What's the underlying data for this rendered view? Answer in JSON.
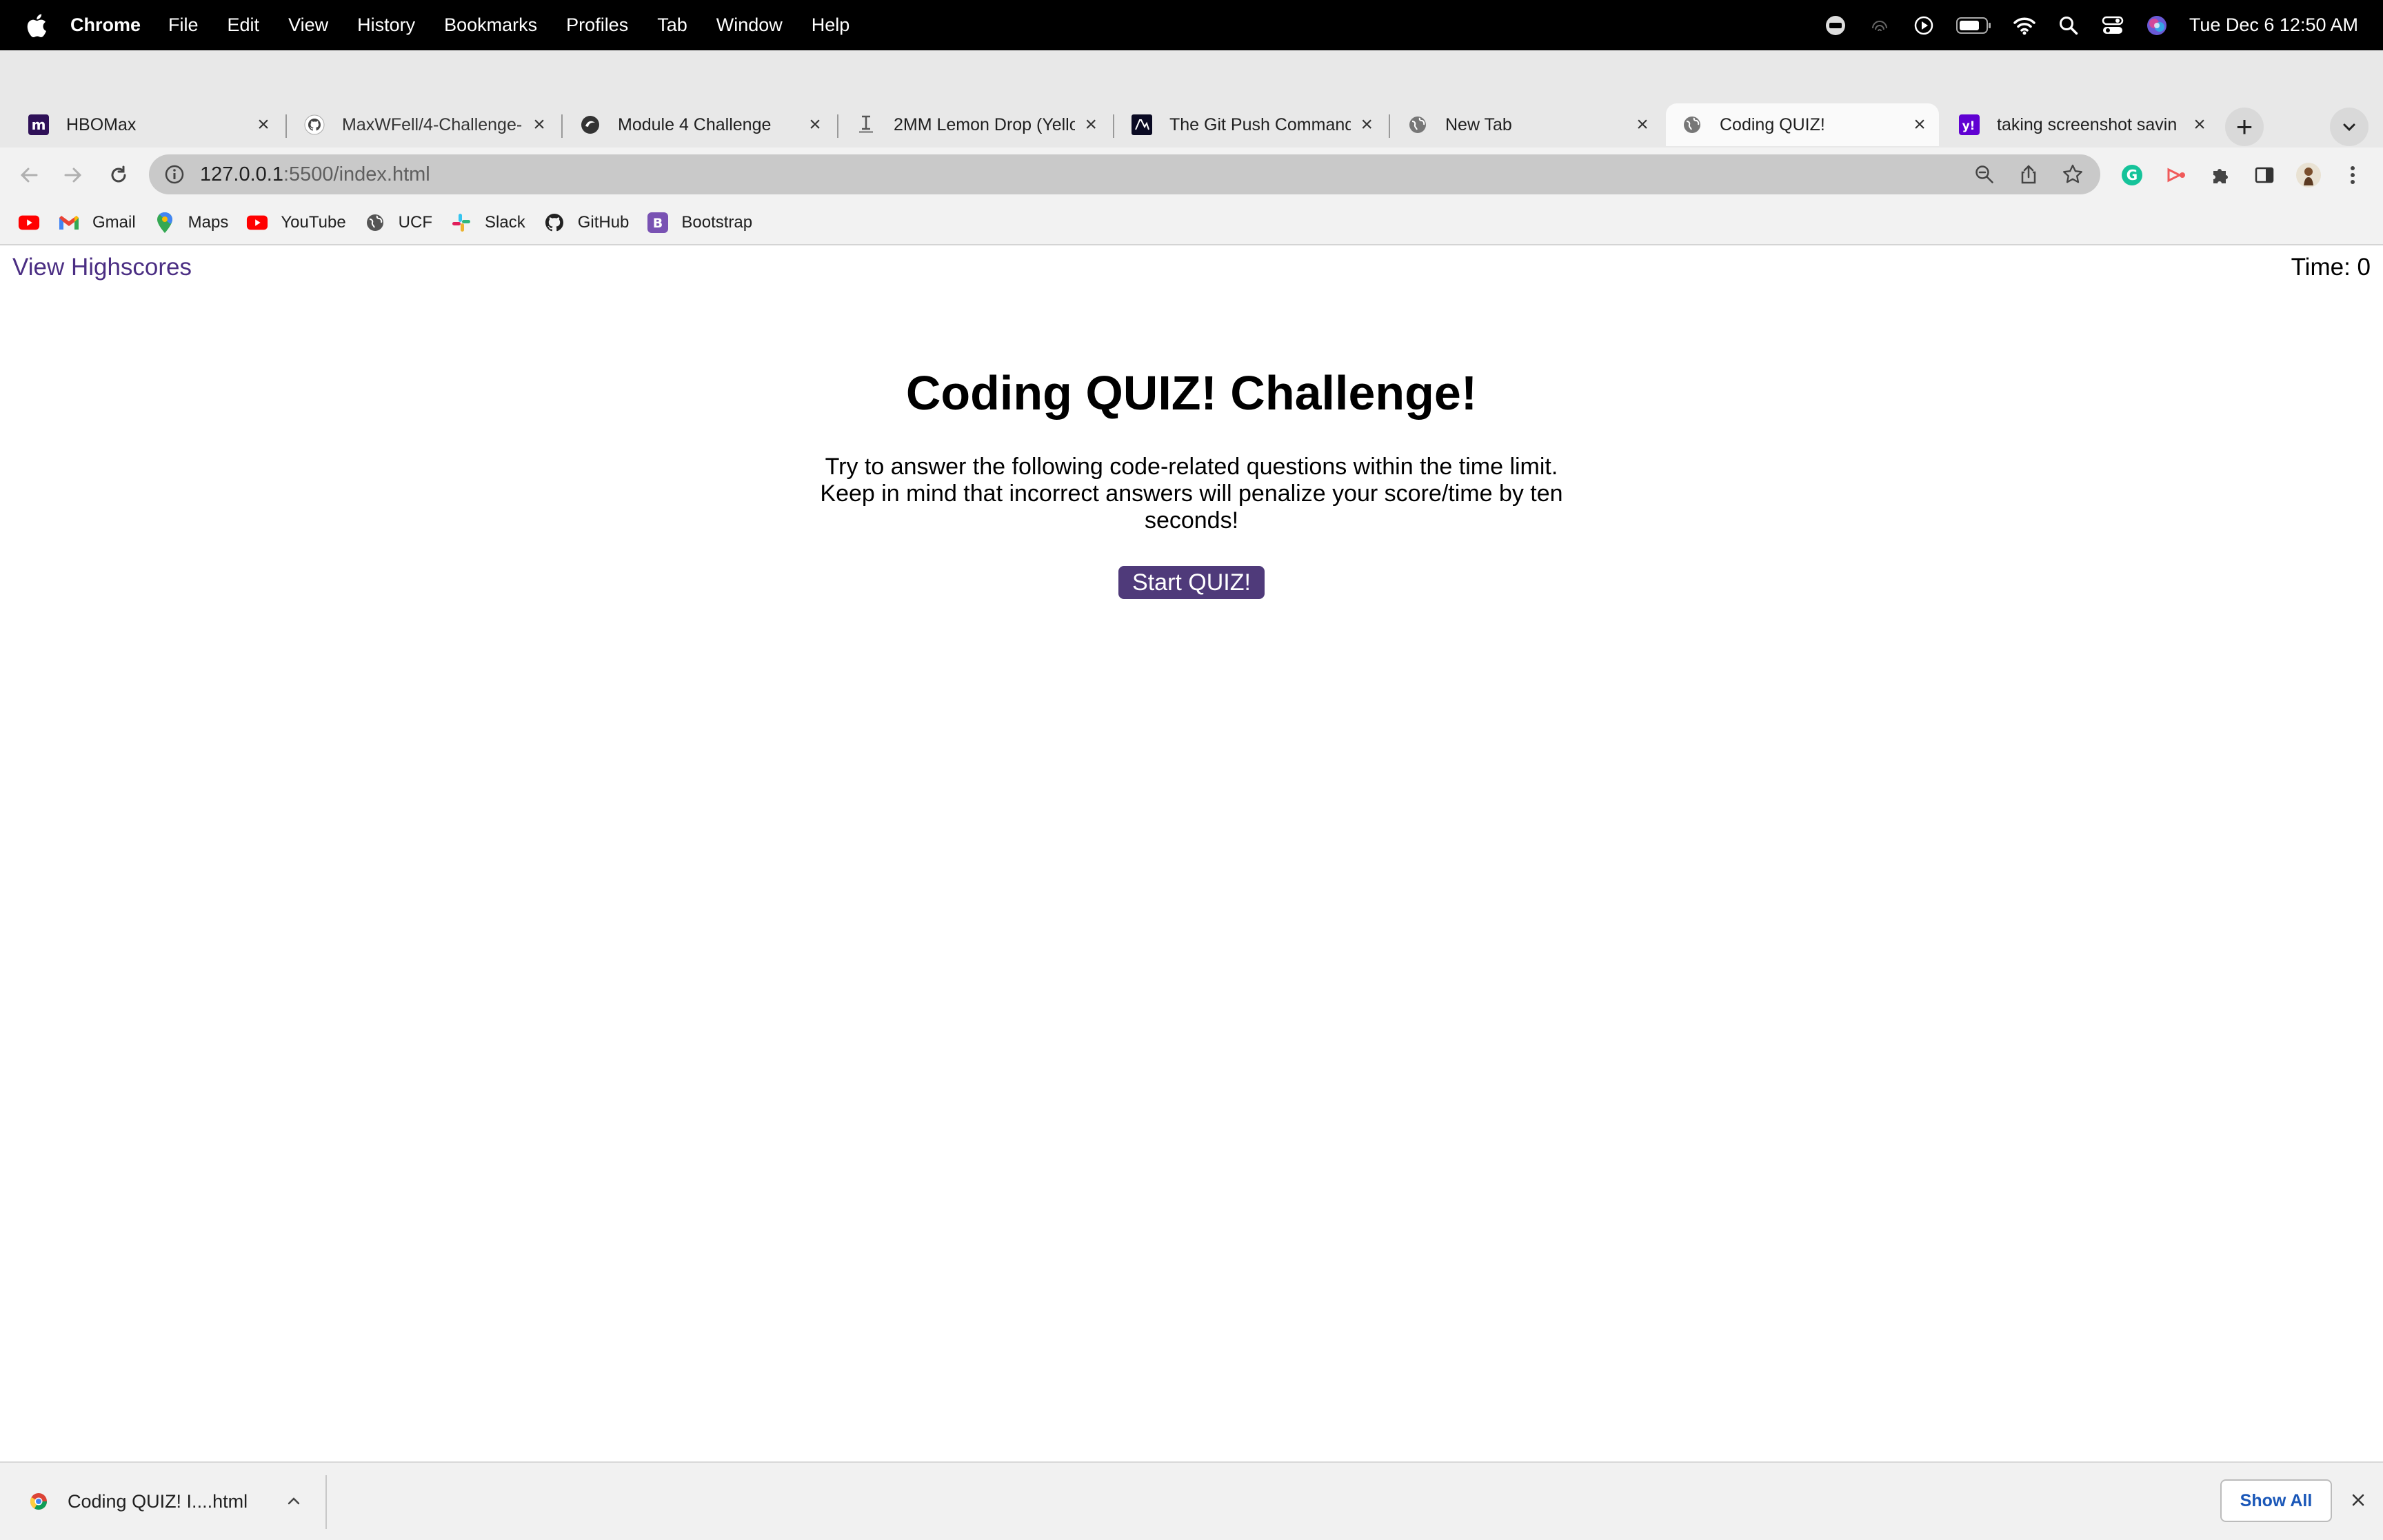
{
  "menubar": {
    "app": "Chrome",
    "items": [
      "File",
      "Edit",
      "View",
      "History",
      "Bookmarks",
      "Profiles",
      "Tab",
      "Window",
      "Help"
    ],
    "clock": "Tue Dec 6  12:50 AM"
  },
  "tabs": [
    {
      "title": "HBOMax",
      "icon": "hbomax-icon"
    },
    {
      "title": "MaxWFell/4-Challenge-",
      "icon": "github-icon"
    },
    {
      "title": "Module 4 Challenge",
      "icon": "canvas-icon"
    },
    {
      "title": "2MM Lemon Drop (Yello",
      "icon": "jacob-icon"
    },
    {
      "title": "The Git Push Command",
      "icon": "freecodecamp-icon"
    },
    {
      "title": "New Tab",
      "icon": "globe-icon"
    },
    {
      "title": "Coding QUIZ!",
      "icon": "globe-icon",
      "active": true
    },
    {
      "title": "taking screenshot savin",
      "icon": "yahoo-icon"
    }
  ],
  "address": {
    "host": "127.0.0.1",
    "path": ":5500/index.html"
  },
  "bookmarks": [
    {
      "label": "",
      "icon": "youtube-icon"
    },
    {
      "label": "Gmail",
      "icon": "gmail-icon"
    },
    {
      "label": "Maps",
      "icon": "maps-icon"
    },
    {
      "label": "YouTube",
      "icon": "youtube-icon"
    },
    {
      "label": "UCF",
      "icon": "globe-icon"
    },
    {
      "label": "Slack",
      "icon": "slack-icon"
    },
    {
      "label": "GitHub",
      "icon": "github-icon"
    },
    {
      "label": "Bootstrap",
      "icon": "bootstrap-icon"
    }
  ],
  "page": {
    "highscores_link": "View Highscores",
    "timer_label": "Time: ",
    "timer_value": "0",
    "title": "Coding QUIZ! Challenge!",
    "intro": "Try to answer the following code-related questions within the time limit. Keep in mind that incorrect answers will penalize your score/time by ten seconds!",
    "start_button": "Start QUIZ!"
  },
  "download_shelf": {
    "file_name": "Coding QUIZ! I....html",
    "show_all": "Show All"
  },
  "colors": {
    "accent": "#4f3a7a",
    "link": "#4b2e83",
    "menubar": "#000000"
  }
}
